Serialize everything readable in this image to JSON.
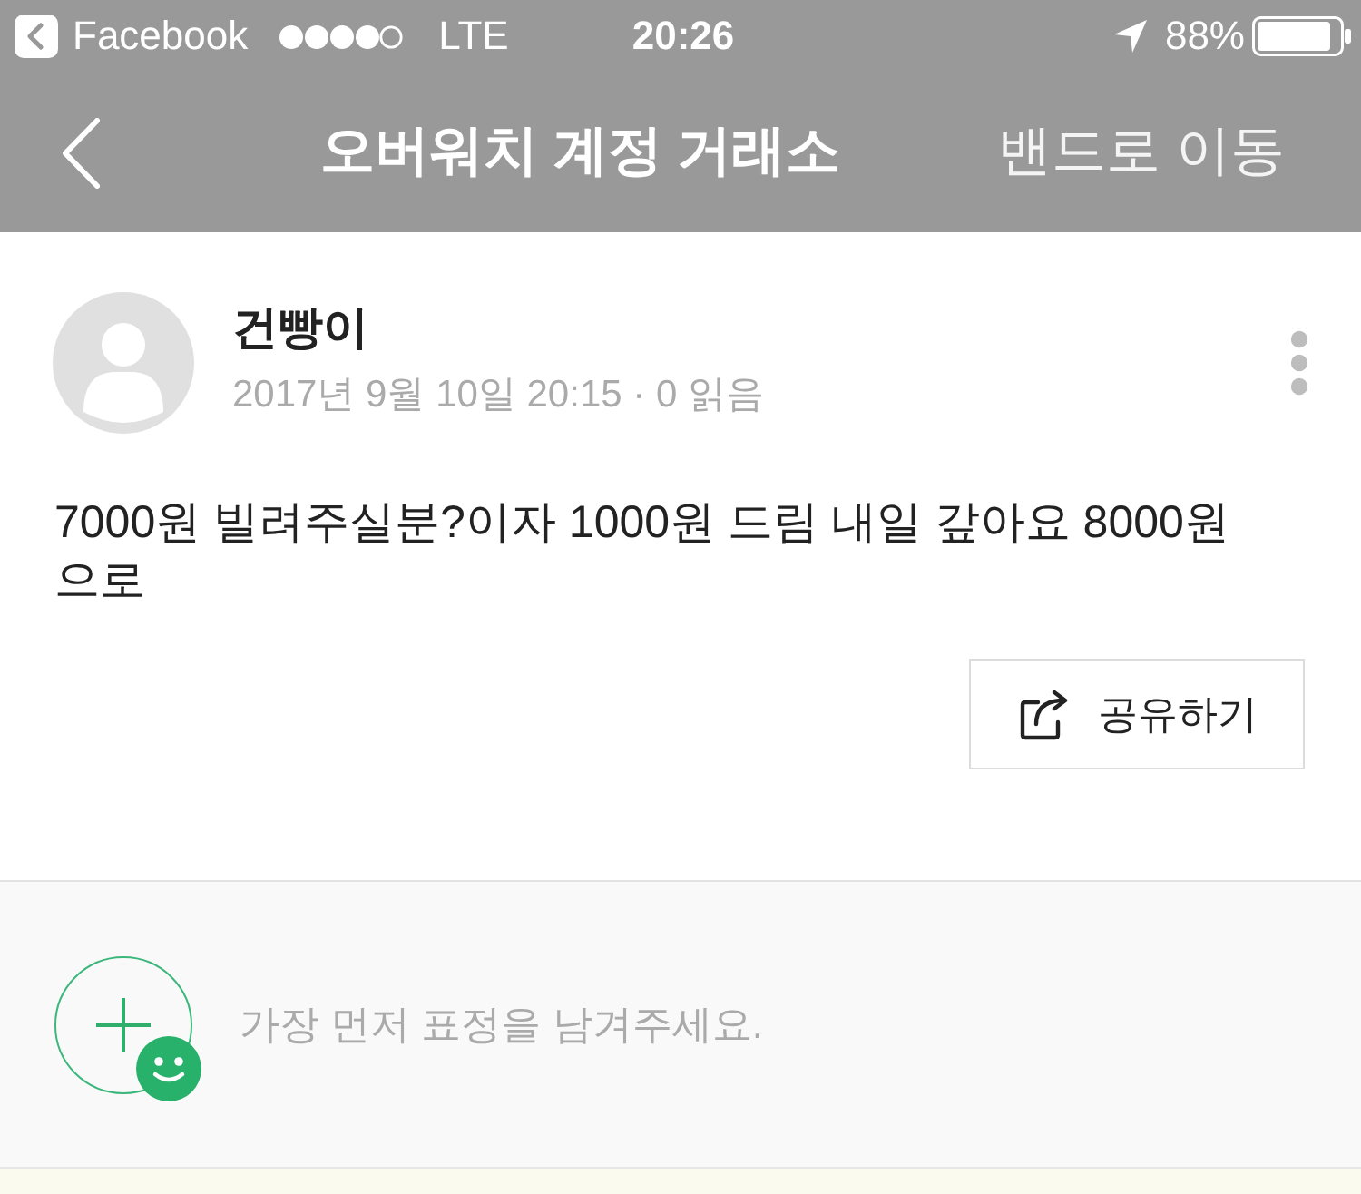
{
  "status_bar": {
    "back_app": "Facebook",
    "network": "LTE",
    "time": "20:26",
    "battery": "88%"
  },
  "nav_bar": {
    "title": "오버워치 계정 거래소",
    "action": "밴드로 이동"
  },
  "post": {
    "author": "건빵이",
    "meta": "2017년 9월 10일 20:15 · 0 읽음",
    "body": "7000원 빌려주실분?이자 1000원 드림 내일 갚아요 8000원 으로",
    "share": "공유하기"
  },
  "reactions": {
    "prompt": "가장 먼저 표정을 남겨주세요."
  }
}
